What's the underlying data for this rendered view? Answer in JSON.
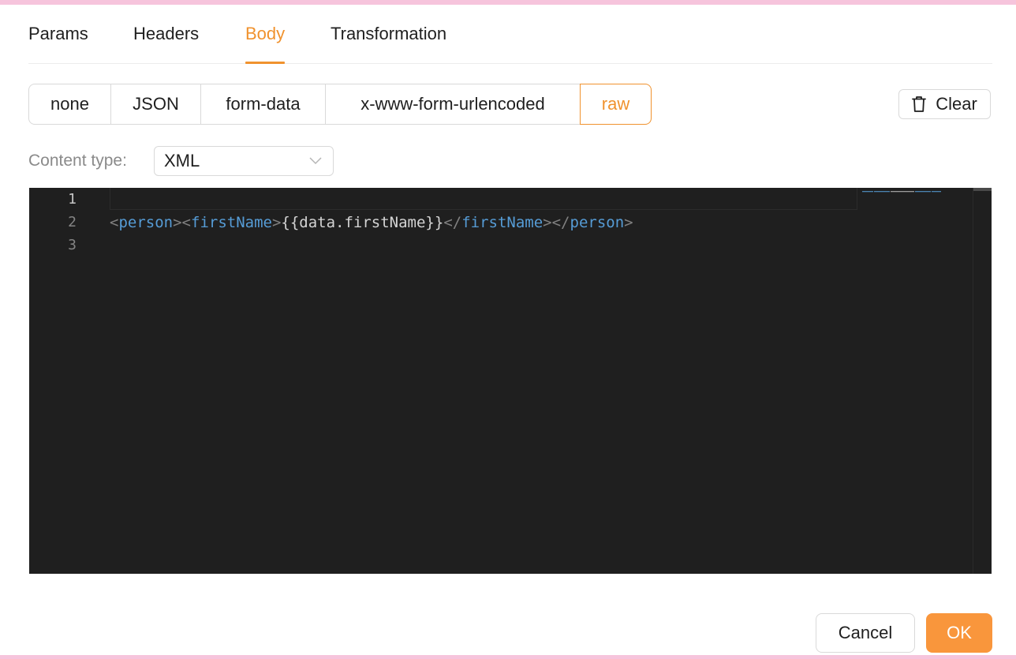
{
  "tabs": [
    {
      "label": "Params",
      "active": false
    },
    {
      "label": "Headers",
      "active": false
    },
    {
      "label": "Body",
      "active": true
    },
    {
      "label": "Transformation",
      "active": false
    }
  ],
  "body_types": [
    {
      "label": "none",
      "active": false
    },
    {
      "label": "JSON",
      "active": false
    },
    {
      "label": "form-data",
      "active": false
    },
    {
      "label": "x-www-form-urlencoded",
      "active": false
    },
    {
      "label": "raw",
      "active": true
    }
  ],
  "clear_button": {
    "label": "Clear",
    "icon": "trash-icon"
  },
  "content_type": {
    "label": "Content type:",
    "value": "XML"
  },
  "editor": {
    "line_numbers": [
      "1",
      "2",
      "3"
    ],
    "lines": [
      "",
      "<person><firstName>{{data.firstName}}</firstName></person>",
      ""
    ]
  },
  "footer": {
    "cancel_label": "Cancel",
    "ok_label": "OK"
  },
  "colors": {
    "accent": "#f0922e",
    "ok_button": "#f9963c",
    "editor_bg": "#1f1f1f",
    "xml_tag": "#569cd6"
  }
}
